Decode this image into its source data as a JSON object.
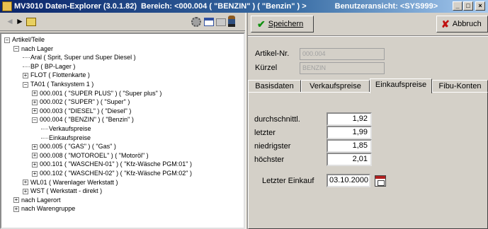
{
  "window": {
    "title_main": "MV3010 Daten-Explorer (3.0.1.82)",
    "title_bereich": "Bereich: <000.004 ( \"BENZIN\" ) ( \"Benzin\" ) >",
    "title_ansicht": "Benutzeransicht: <SYS999>",
    "btn_min": "_",
    "btn_max": "□",
    "btn_close": "×"
  },
  "toolbar": {
    "back": "◄",
    "forward": "►"
  },
  "tree": [
    {
      "pm": "−",
      "label": "Artikel/Teile",
      "indent": 0
    },
    {
      "pm": "−",
      "label": "nach Lager",
      "indent": 1
    },
    {
      "pm": "",
      "label": "Aral ( Sprit, Super und Super Diesel )",
      "indent": 2
    },
    {
      "pm": "",
      "label": "BP ( BP-Lager )",
      "indent": 2
    },
    {
      "pm": "+",
      "label": "FLOT ( Flottenkarte )",
      "indent": 2
    },
    {
      "pm": "−",
      "label": "TA01 ( Tanksystem 1 )",
      "indent": 2
    },
    {
      "pm": "+",
      "label": "000.001 ( \"SUPER PLUS\" ) ( \"Super plus\" )",
      "indent": 3
    },
    {
      "pm": "+",
      "label": "000.002 ( \"SUPER\" ) ( \"Super\" )",
      "indent": 3
    },
    {
      "pm": "+",
      "label": "000.003 ( \"DIESEL\" ) ( \"Diesel\" )",
      "indent": 3
    },
    {
      "pm": "−",
      "label": "000.004 ( \"BENZIN\" ) ( \"Benzin\" )",
      "indent": 3
    },
    {
      "pm": "",
      "label": "Verkaufspreise",
      "indent": 4
    },
    {
      "pm": "",
      "label": "Einkaufspreise",
      "indent": 4
    },
    {
      "pm": "+",
      "label": "000.005 ( \"GAS\" ) ( \"Gas\" )",
      "indent": 3
    },
    {
      "pm": "+",
      "label": "000.008 ( \"MOTOROEL\" ) ( \"Motoröl\" )",
      "indent": 3
    },
    {
      "pm": "+",
      "label": "000.101 ( \"WASCHEN-01\" ) ( \"Kfz-Wäsche PGM:01\" )",
      "indent": 3
    },
    {
      "pm": "+",
      "label": "000.102 ( \"WASCHEN-02\" ) ( \"Kfz-Wäsche PGM:02\" )",
      "indent": 3
    },
    {
      "pm": "+",
      "label": "WL01 ( Warenlager Werkstatt )",
      "indent": 2
    },
    {
      "pm": "+",
      "label": "WST ( Werkstatt - direkt )",
      "indent": 2
    },
    {
      "pm": "+",
      "label": "nach Lagerort",
      "indent": 1
    },
    {
      "pm": "+",
      "label": "nach Warengruppe",
      "indent": 1
    }
  ],
  "form": {
    "save_label": "Speichern",
    "cancel_label": "Abbruch",
    "artikel_label": "Artikel-Nr.",
    "artikel_value": "000.004",
    "kuerzel_label": "Kürzel",
    "kuerzel_value": "BENZIN"
  },
  "tabs": [
    {
      "label": "Basisdaten",
      "active": false
    },
    {
      "label": "Verkaufspreise",
      "active": false
    },
    {
      "label": "Einkaufspreise",
      "active": true
    },
    {
      "label": "Fibu-Konten",
      "active": false
    }
  ],
  "prices": {
    "durchschnitt_label": "durchschnittl.",
    "durchschnitt_value": "1,92",
    "letzter_label": "letzter",
    "letzter_value": "1,99",
    "niedrigster_label": "niedrigster",
    "niedrigster_value": "1,85",
    "hoechster_label": "höchster",
    "hoechster_value": "2,01",
    "letzter_einkauf_label": "Letzter Einkauf",
    "letzter_einkauf_value": "03.10.2000"
  },
  "icons": [
    "app-icon",
    "back-arrow-icon",
    "forward-arrow-icon",
    "folder-up-icon",
    "settings-gear-icon",
    "table-view-icon",
    "folder-icon",
    "person-icon",
    "checkmark-icon",
    "x-icon",
    "calendar-icon"
  ]
}
